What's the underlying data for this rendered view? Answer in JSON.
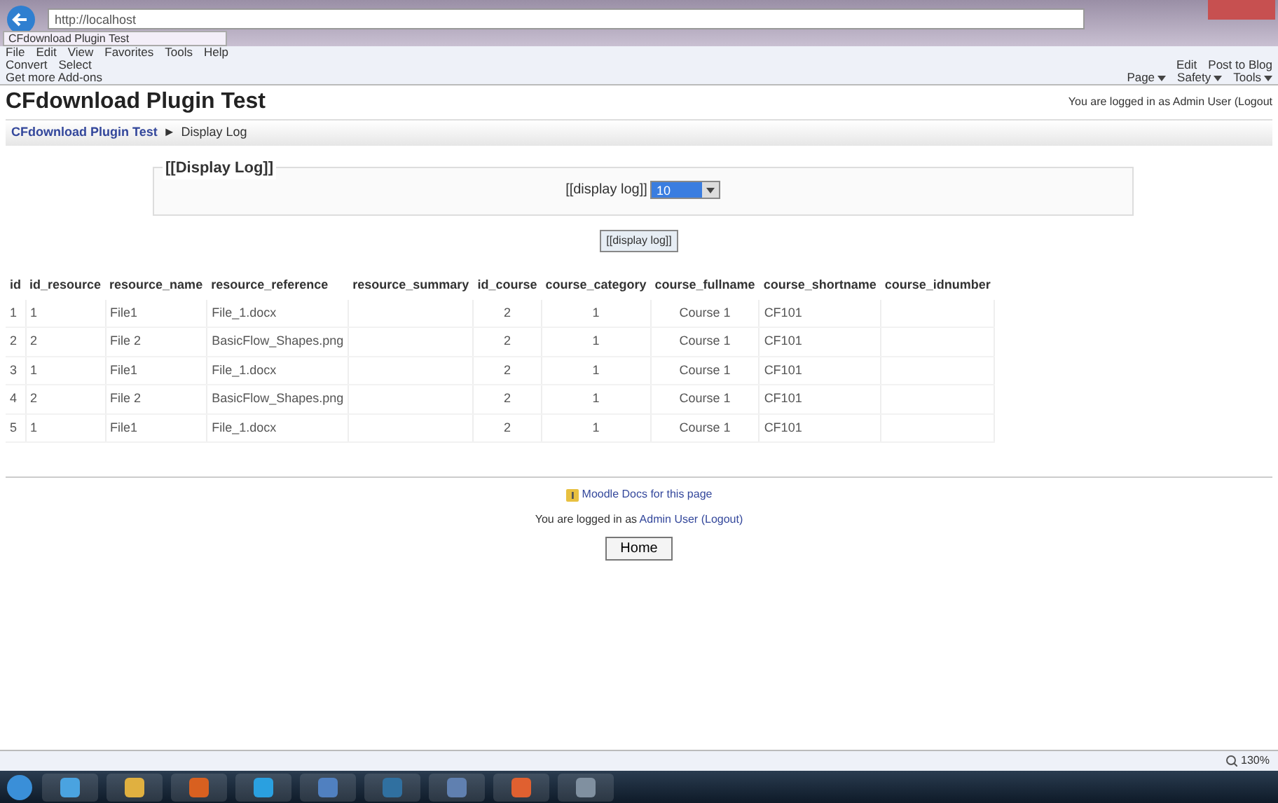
{
  "browser": {
    "address": "http://localhost",
    "tab": "CFdownload Plugin Test",
    "menu": [
      "File",
      "Edit",
      "View",
      "Favorites",
      "Tools",
      "Help"
    ],
    "toolbar": [
      "Convert",
      "Select"
    ],
    "addons": "Get more Add-ons",
    "toolbar_right": [
      "Edit",
      "Post to Blog"
    ],
    "command_bar": [
      "Page",
      "Safety",
      "Tools"
    ]
  },
  "page": {
    "site_title": "CFdownload Plugin Test",
    "login_top": "You are logged in as Admin User (Logout",
    "breadcrumb": [
      "CFdownload Plugin Test",
      "Display Log"
    ],
    "separator": "►",
    "form": {
      "legend": "[[Display Log]]",
      "label": "[[display log]]",
      "select_value": "10",
      "button": "[[display log]]"
    },
    "table": {
      "columns": [
        "id",
        "id_resource",
        "resource_name",
        "resource_reference",
        "resource_summary",
        "id_course",
        "course_category",
        "course_fullname",
        "course_shortname",
        "course_idnumber"
      ],
      "rows": [
        [
          "1",
          "1",
          "File1",
          "File_1.docx",
          "",
          "2",
          "1",
          "Course 1",
          "CF101",
          ""
        ],
        [
          "2",
          "2",
          "File 2",
          "BasicFlow_Shapes.png",
          "",
          "2",
          "1",
          "Course 1",
          "CF101",
          ""
        ],
        [
          "3",
          "1",
          "File1",
          "File_1.docx",
          "",
          "2",
          "1",
          "Course 1",
          "CF101",
          ""
        ],
        [
          "4",
          "2",
          "File 2",
          "BasicFlow_Shapes.png",
          "",
          "2",
          "1",
          "Course 1",
          "CF101",
          ""
        ],
        [
          "5",
          "1",
          "File1",
          "File_1.docx",
          "",
          "2",
          "1",
          "Course 1",
          "CF101",
          ""
        ]
      ]
    },
    "footer": {
      "docs_link": "Moodle Docs for this page",
      "login_prefix": "You are logged in as ",
      "user": "Admin User",
      "logout": "(Logout)",
      "home": "Home"
    }
  },
  "status": {
    "zoom": "130%"
  }
}
